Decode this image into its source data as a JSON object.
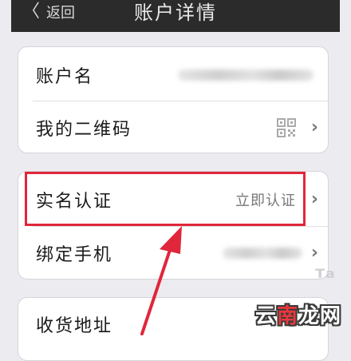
{
  "navbar": {
    "back_label": "返回",
    "title": "账户详情"
  },
  "card1": {
    "account_name_label": "账户名",
    "qr_code_label": "我的二维码"
  },
  "card2": {
    "real_name_label": "实名认证",
    "real_name_value": "立即认证",
    "bind_phone_label": "绑定手机"
  },
  "card3": {
    "address_label": "收货地址"
  },
  "icons": {
    "qr": "qr-code-icon",
    "chevron": "chevron-right-icon",
    "back": "chevron-left-icon"
  },
  "colors": {
    "navbar": "#2b2b2b",
    "highlight": "#e0263a",
    "background": "#ecebf0"
  },
  "watermark": {
    "part1": "云",
    "part2": "南",
    "part3": "龙网"
  }
}
